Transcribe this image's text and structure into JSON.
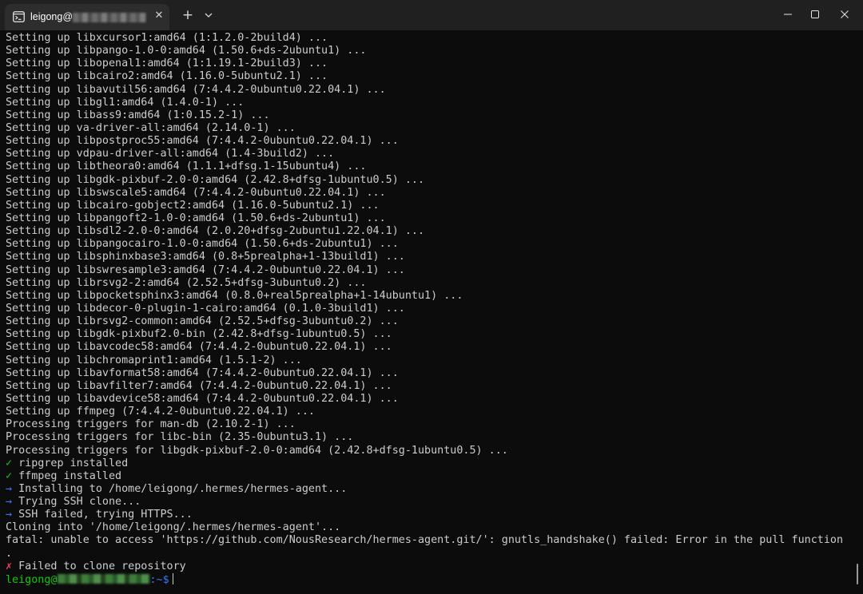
{
  "tab": {
    "title": "leigong@"
  },
  "titlebar": {
    "new_tab_label": "+",
    "close_tab_label": "✕"
  },
  "terminal": {
    "lines": [
      {
        "text": "Setting up libxcursor1:amd64 (1:1.2.0-2build4) ...",
        "kind": "plain"
      },
      {
        "text": "Setting up libpango-1.0-0:amd64 (1.50.6+ds-2ubuntu1) ...",
        "kind": "plain"
      },
      {
        "text": "Setting up libopenal1:amd64 (1:1.19.1-2build3) ...",
        "kind": "plain"
      },
      {
        "text": "Setting up libcairo2:amd64 (1.16.0-5ubuntu2.1) ...",
        "kind": "plain"
      },
      {
        "text": "Setting up libavutil56:amd64 (7:4.4.2-0ubuntu0.22.04.1) ...",
        "kind": "plain"
      },
      {
        "text": "Setting up libgl1:amd64 (1.4.0-1) ...",
        "kind": "plain"
      },
      {
        "text": "Setting up libass9:amd64 (1:0.15.2-1) ...",
        "kind": "plain"
      },
      {
        "text": "Setting up va-driver-all:amd64 (2.14.0-1) ...",
        "kind": "plain"
      },
      {
        "text": "Setting up libpostproc55:amd64 (7:4.4.2-0ubuntu0.22.04.1) ...",
        "kind": "plain"
      },
      {
        "text": "Setting up vdpau-driver-all:amd64 (1.4-3build2) ...",
        "kind": "plain"
      },
      {
        "text": "Setting up libtheora0:amd64 (1.1.1+dfsg.1-15ubuntu4) ...",
        "kind": "plain"
      },
      {
        "text": "Setting up libgdk-pixbuf-2.0-0:amd64 (2.42.8+dfsg-1ubuntu0.5) ...",
        "kind": "plain"
      },
      {
        "text": "Setting up libswscale5:amd64 (7:4.4.2-0ubuntu0.22.04.1) ...",
        "kind": "plain"
      },
      {
        "text": "Setting up libcairo-gobject2:amd64 (1.16.0-5ubuntu2.1) ...",
        "kind": "plain"
      },
      {
        "text": "Setting up libpangoft2-1.0-0:amd64 (1.50.6+ds-2ubuntu1) ...",
        "kind": "plain"
      },
      {
        "text": "Setting up libsdl2-2.0-0:amd64 (2.0.20+dfsg-2ubuntu1.22.04.1) ...",
        "kind": "plain"
      },
      {
        "text": "Setting up libpangocairo-1.0-0:amd64 (1.50.6+ds-2ubuntu1) ...",
        "kind": "plain"
      },
      {
        "text": "Setting up libsphinxbase3:amd64 (0.8+5prealpha+1-13build1) ...",
        "kind": "plain"
      },
      {
        "text": "Setting up libswresample3:amd64 (7:4.4.2-0ubuntu0.22.04.1) ...",
        "kind": "plain"
      },
      {
        "text": "Setting up librsvg2-2:amd64 (2.52.5+dfsg-3ubuntu0.2) ...",
        "kind": "plain"
      },
      {
        "text": "Setting up libpocketsphinx3:amd64 (0.8.0+real5prealpha+1-14ubuntu1) ...",
        "kind": "plain"
      },
      {
        "text": "Setting up libdecor-0-plugin-1-cairo:amd64 (0.1.0-3build1) ...",
        "kind": "plain"
      },
      {
        "text": "Setting up librsvg2-common:amd64 (2.52.5+dfsg-3ubuntu0.2) ...",
        "kind": "plain"
      },
      {
        "text": "Setting up libgdk-pixbuf2.0-bin (2.42.8+dfsg-1ubuntu0.5) ...",
        "kind": "plain"
      },
      {
        "text": "Setting up libavcodec58:amd64 (7:4.4.2-0ubuntu0.22.04.1) ...",
        "kind": "plain"
      },
      {
        "text": "Setting up libchromaprint1:amd64 (1.5.1-2) ...",
        "kind": "plain"
      },
      {
        "text": "Setting up libavformat58:amd64 (7:4.4.2-0ubuntu0.22.04.1) ...",
        "kind": "plain"
      },
      {
        "text": "Setting up libavfilter7:amd64 (7:4.4.2-0ubuntu0.22.04.1) ...",
        "kind": "plain"
      },
      {
        "text": "Setting up libavdevice58:amd64 (7:4.4.2-0ubuntu0.22.04.1) ...",
        "kind": "plain"
      },
      {
        "text": "Setting up ffmpeg (7:4.4.2-0ubuntu0.22.04.1) ...",
        "kind": "plain"
      },
      {
        "text": "Processing triggers for man-db (2.10.2-1) ...",
        "kind": "plain"
      },
      {
        "text": "Processing triggers for libc-bin (2.35-0ubuntu3.1) ...",
        "kind": "plain"
      },
      {
        "text": "Processing triggers for libgdk-pixbuf-2.0-0:amd64 (2.42.8+dfsg-1ubuntu0.5) ...",
        "kind": "plain"
      },
      {
        "text": "ripgrep installed",
        "kind": "check",
        "symbol": "✓"
      },
      {
        "text": "ffmpeg installed",
        "kind": "check",
        "symbol": "✓"
      },
      {
        "text": "Installing to /home/leigong/.hermes/hermes-agent...",
        "kind": "arrow",
        "symbol": "→"
      },
      {
        "text": "Trying SSH clone...",
        "kind": "arrow",
        "symbol": "→"
      },
      {
        "text": "SSH failed, trying HTTPS...",
        "kind": "arrow",
        "symbol": "→"
      },
      {
        "text": "Cloning into '/home/leigong/.hermes/hermes-agent'...",
        "kind": "plain"
      },
      {
        "text": "fatal: unable to access 'https://github.com/NousResearch/hermes-agent.git/': gnutls_handshake() failed: Error in the pull function",
        "kind": "plain"
      },
      {
        "text": ".",
        "kind": "plain"
      },
      {
        "text": "Failed to clone repository",
        "kind": "cross",
        "symbol": "✗"
      }
    ],
    "prompt": {
      "user": "leigong@",
      "path": ":~$"
    }
  },
  "icons": {
    "tab": "terminal-icon",
    "close_tab": "close-icon",
    "new_tab": "plus-icon",
    "dropdown": "chevron-down-icon",
    "minimize": "minimize-icon",
    "maximize": "maximize-icon",
    "close_window": "close-icon"
  },
  "colors": {
    "background": "#0c0c0c",
    "titlebar": "#202020",
    "tab": "#2d2d2d",
    "text": "#cccccc",
    "success": "#16c60c",
    "info": "#3b78ff",
    "error": "#e74856"
  }
}
